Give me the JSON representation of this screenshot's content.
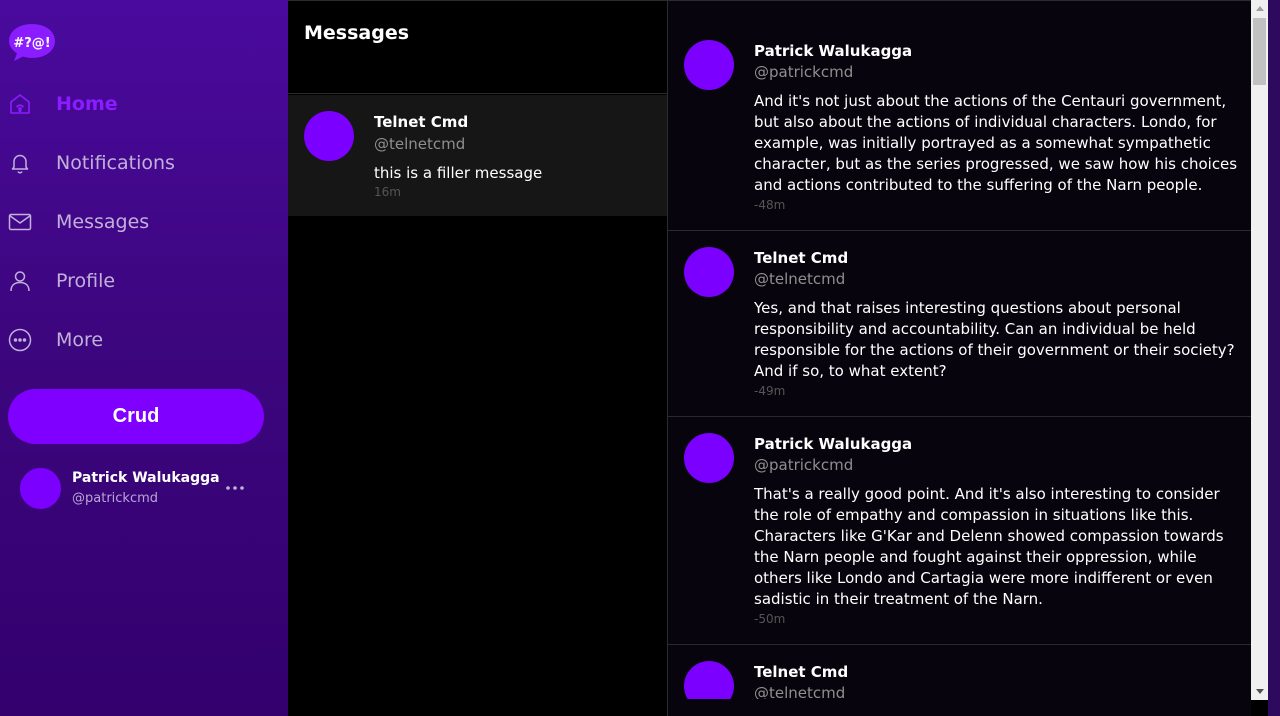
{
  "sidebar": {
    "logo_text": "#?@!",
    "nav": [
      {
        "label": "Home",
        "icon": "home-icon",
        "active": true
      },
      {
        "label": "Notifications",
        "icon": "bell-icon",
        "active": false
      },
      {
        "label": "Messages",
        "icon": "mail-icon",
        "active": false
      },
      {
        "label": "Profile",
        "icon": "user-icon",
        "active": false
      },
      {
        "label": "More",
        "icon": "more-circle-icon",
        "active": false
      }
    ],
    "crud_label": "Crud",
    "account": {
      "name": "Patrick Walukagga",
      "handle": "@patrickcmd"
    }
  },
  "messages_panel": {
    "title": "Messages",
    "conversations": [
      {
        "name": "Telnet Cmd",
        "handle": "@telnetcmd",
        "preview": "this is a filler message",
        "time": "16m"
      }
    ]
  },
  "thread": {
    "messages": [
      {
        "name": "Patrick Walukagga",
        "handle": "@patrickcmd",
        "text": "And it's not just about the actions of the Centauri government, but also about the actions of individual characters. Londo, for example, was initially portrayed as a somewhat sympathetic character, but as the series progressed, we saw how his choices and actions contributed to the suffering of the Narn people.",
        "time": "-48m"
      },
      {
        "name": "Telnet Cmd",
        "handle": "@telnetcmd",
        "text": "Yes, and that raises interesting questions about personal responsibility and accountability. Can an individual be held responsible for the actions of their government or their society? And if so, to what extent?",
        "time": "-49m"
      },
      {
        "name": "Patrick Walukagga",
        "handle": "@patrickcmd",
        "text": "That's a really good point. And it's also interesting to consider the role of empathy and compassion in situations like this. Characters like G'Kar and Delenn showed compassion towards the Narn people and fought against their oppression, while others like Londo and Cartagia were more indifferent or even sadistic in their treatment of the Narn.",
        "time": "-50m"
      },
      {
        "name": "Telnet Cmd",
        "handle": "@telnetcmd",
        "text": "",
        "time": ""
      }
    ]
  },
  "colors": {
    "accent": "#8000ff",
    "avatar": "#7c00ff",
    "sidebar_bg": "#3d067f"
  }
}
